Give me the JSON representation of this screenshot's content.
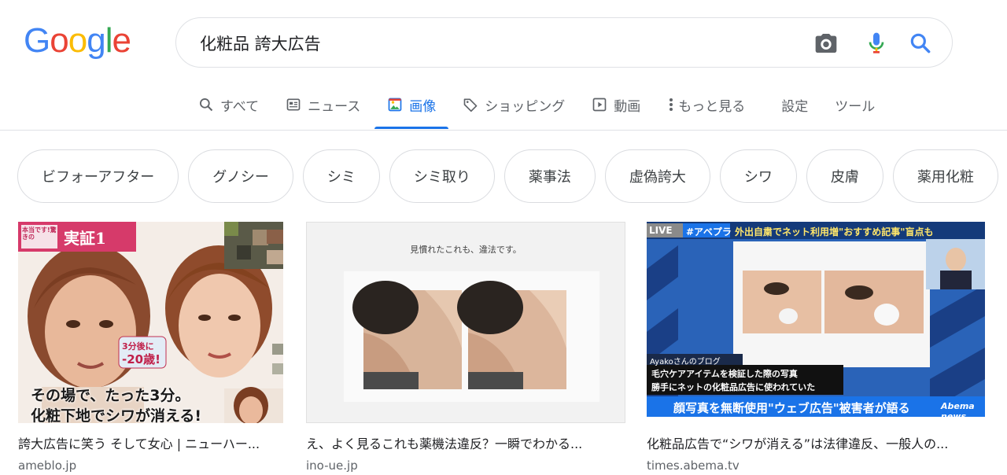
{
  "logo": {
    "letters": [
      "G",
      "o",
      "o",
      "g",
      "l",
      "e"
    ],
    "colors": [
      "#4285F4",
      "#EA4335",
      "#FBBC05",
      "#4285F4",
      "#34A853",
      "#EA4335"
    ]
  },
  "search": {
    "query": "化粧品 誇大広告",
    "icons": [
      "camera-icon",
      "microphone-icon",
      "search-icon"
    ]
  },
  "tabs": [
    {
      "label": "すべて",
      "icon": "search-icon",
      "active": false
    },
    {
      "label": "ニュース",
      "icon": "news-icon",
      "active": false
    },
    {
      "label": "画像",
      "icon": "image-icon",
      "active": true
    },
    {
      "label": "ショッピング",
      "icon": "tag-icon",
      "active": false
    },
    {
      "label": "動画",
      "icon": "play-icon",
      "active": false
    },
    {
      "label": "もっと見る",
      "icon": "more-vert-icon",
      "active": false
    }
  ],
  "tools": {
    "settings": "設定",
    "tools": "ツール"
  },
  "chips": [
    "ビフォーアフター",
    "グノシー",
    "シミ",
    "シミ取り",
    "薬事法",
    "虚偽誇大",
    "シワ",
    "皮膚",
    "薬用化粧"
  ],
  "results": [
    {
      "title": "誇大広告に笑う そして女心 | ニューハー...",
      "site": "ameblo.jp",
      "overlay": {
        "badge": "実証1",
        "corner": "本当です!驚きの",
        "bubble_1": "3分後に",
        "bubble_2": "-20歳!",
        "caption_1": "その場で、たった3分。",
        "caption_2": "化粧下地でシワが消える!"
      }
    },
    {
      "title": "え、よく見るこれも薬機法違反？一瞬でわかる...",
      "site": "ino-ue.jp",
      "overlay": {
        "heading": "見慣れたこれも、違法です。"
      }
    },
    {
      "title": "化粧品広告で“シワが消える”は法律違反、一般人の...",
      "site": "times.abema.tv",
      "overlay": {
        "live": "LIVE",
        "tag": "#アベプラ",
        "headline": "外出自粛でネット利用増\"おすすめ記事\"盲点も",
        "blog": "Ayakoさんのブログ",
        "line_1": "毛穴ケアアイテムを検証した際の写真",
        "line_2": "勝手にネットの化粧品広告に使われていた",
        "banner": "顔写真を無断使用\"ウェブ広告\"被害者が語る",
        "watermark": "Abema news"
      }
    }
  ]
}
